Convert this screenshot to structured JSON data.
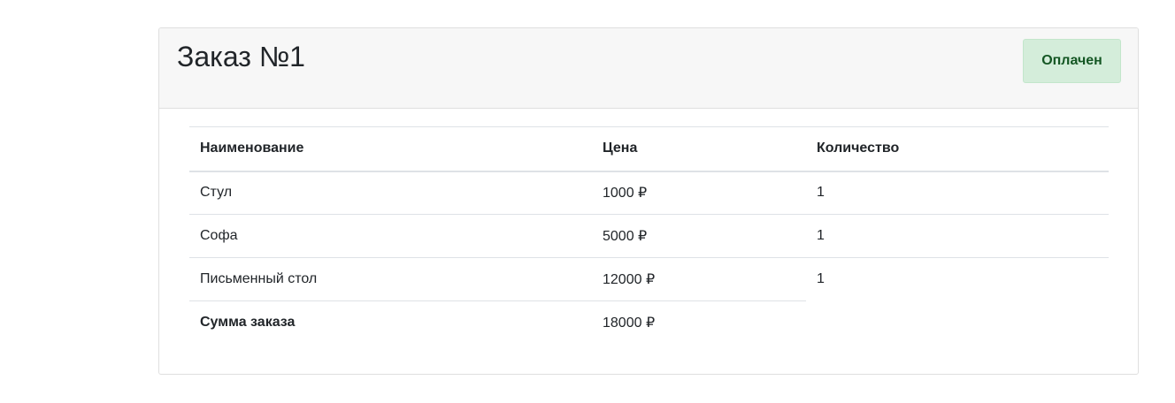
{
  "order": {
    "title": "Заказ №1",
    "status": "Оплачен",
    "colors": {
      "status_bg": "#d4edda",
      "status_text": "#155724",
      "header_bg": "#f7f7f7"
    }
  },
  "table": {
    "headers": {
      "name": "Наименование",
      "price": "Цена",
      "quantity": "Количество"
    },
    "rows": [
      {
        "name": "Стул",
        "price": "1000 ₽",
        "quantity": "1"
      },
      {
        "name": "Софа",
        "price": "5000 ₽",
        "quantity": "1"
      },
      {
        "name": "Письменный стол",
        "price": "12000 ₽",
        "quantity": "1"
      }
    ],
    "total": {
      "label": "Сумма заказа",
      "value": "18000 ₽"
    }
  }
}
